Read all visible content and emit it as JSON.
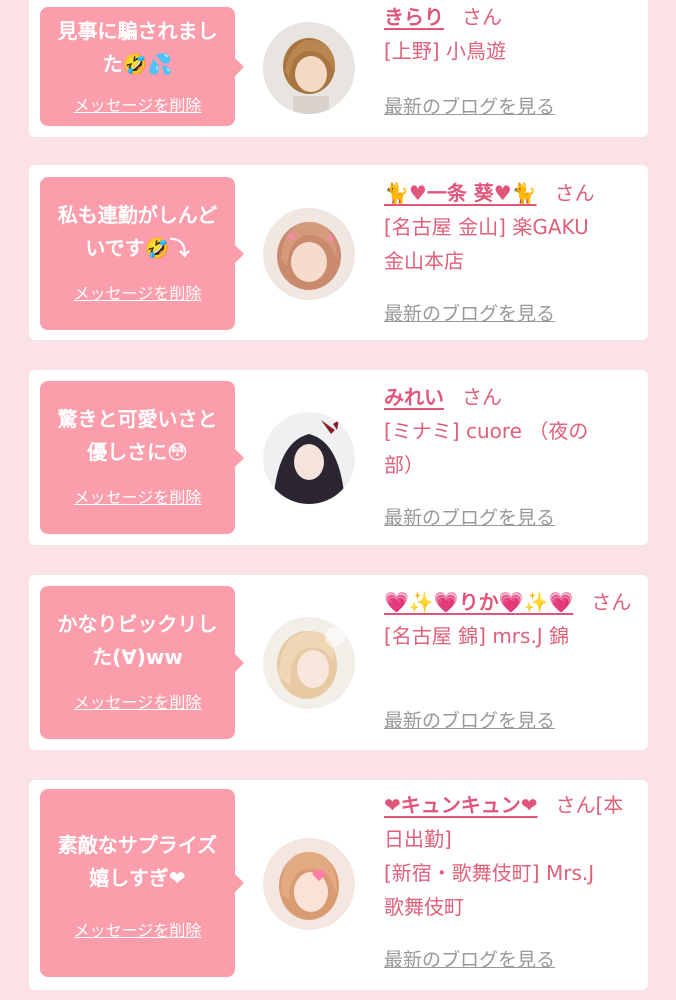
{
  "colors": {
    "background": "#fbe2e6",
    "bubble": "#fb9daa",
    "name": "#e2557a",
    "text": "#e0607a",
    "link_gray": "#999999"
  },
  "items": [
    {
      "message": "見事に騙されまし\nた🤣💦",
      "delete_label": "メッセージを削除",
      "name": "きらり",
      "suffix": "さん",
      "shop": "[上野] 小鳥遊",
      "blog_link": "最新のブログを見る"
    },
    {
      "message": "私も連勤がしんど\nいです🤣⤵",
      "delete_label": "メッセージを削除",
      "name": "🐈♥一条 葵♥🐈",
      "suffix": "さん",
      "shop": "[名古屋 金山] 楽GAKU\n金山本店",
      "blog_link": "最新のブログを見る"
    },
    {
      "message": "驚きと可愛いさと\n優しさに😳",
      "delete_label": "メッセージを削除",
      "name": "みれい",
      "suffix": "さん",
      "shop": "[ミナミ] cuore （夜の\n部）",
      "blog_link": "最新のブログを見る"
    },
    {
      "message": "かなりビックリし\nた(∀)ww",
      "delete_label": "メッセージを削除",
      "name": "💗✨💗りか💗✨💗",
      "suffix": "さん",
      "shop": "[名古屋 錦] mrs.J 錦",
      "blog_link": "最新のブログを見る"
    },
    {
      "message": "素敵なサプライズ\n嬉しすぎ❤",
      "delete_label": "メッセージを削除",
      "name": "❤キュンキュン❤",
      "suffix": "さん[本日出勤]",
      "shop": "[新宿・歌舞伎町] Mrs.J\n歌舞伎町",
      "blog_link": "最新のブログを見る"
    }
  ]
}
